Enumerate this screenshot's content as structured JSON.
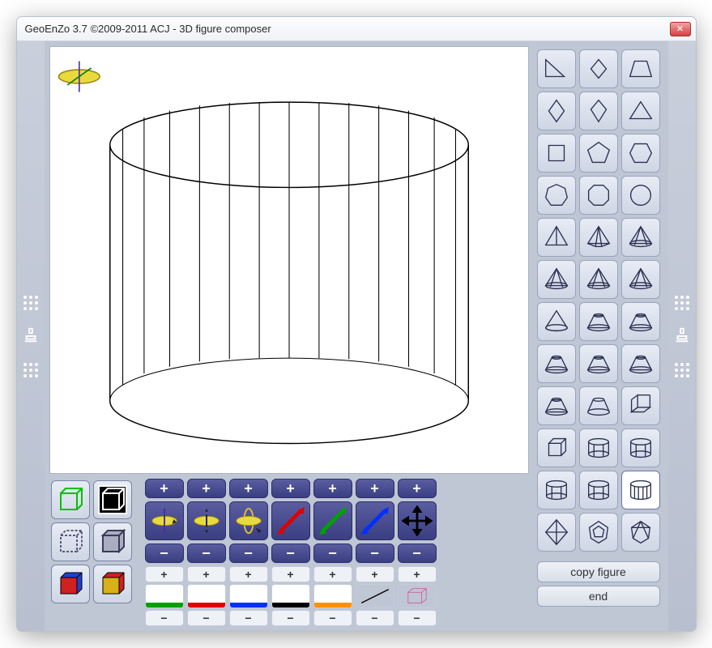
{
  "title": "GeoEnZo 3.7 ©2009-2011 ACJ - 3D figure composer",
  "buttons": {
    "copy_figure": "copy figure",
    "end": "end",
    "plus": "+",
    "minus": "−"
  },
  "render_modes": [
    {
      "name": "wire-green-icon"
    },
    {
      "name": "wire-black-icon"
    },
    {
      "name": "wire-dashed-icon"
    },
    {
      "name": "wire-hidden-icon"
    },
    {
      "name": "solid-color-icon"
    },
    {
      "name": "solid-shade-icon"
    }
  ],
  "transforms": [
    {
      "name": "rotate-z-icon"
    },
    {
      "name": "rotate-y-icon"
    },
    {
      "name": "rotate-x-icon"
    },
    {
      "name": "scale-x-icon"
    },
    {
      "name": "scale-y-icon"
    },
    {
      "name": "scale-z-icon"
    },
    {
      "name": "move-icon"
    }
  ],
  "swatches": [
    {
      "name": "green-swatch",
      "color": "#00a000"
    },
    {
      "name": "red-swatch",
      "color": "#e00000"
    },
    {
      "name": "blue-swatch",
      "color": "#0030ff"
    },
    {
      "name": "black-swatch",
      "color": "#000"
    },
    {
      "name": "orange-swatch",
      "color": "#ff9000"
    }
  ],
  "extra_swatches": [
    {
      "name": "line-style-icon"
    },
    {
      "name": "cube-preview-icon"
    }
  ],
  "shapes": [
    "right-triangle",
    "rhombus",
    "trapezoid",
    "diamond",
    "kite",
    "triangle",
    "square",
    "pentagon",
    "hexagon",
    "heptagon",
    "octagon",
    "circle",
    "tetrahedron",
    "square-pyramid",
    "pentagonal-pyramid",
    "hexagonal-pyramid",
    "heptagonal-pyramid",
    "octagonal-pyramid",
    "cone",
    "frustum-tri",
    "frustum-square",
    "frustum-pent",
    "frustum-hex",
    "frustum-hept",
    "frustum-oct",
    "frustum-cone",
    "wedge-prism",
    "cube",
    "pentagonal-prism",
    "hexagonal-prism",
    "heptagonal-prism",
    "octagonal-prism",
    "cylinder",
    "octahedron",
    "dodecahedron",
    "icosahedron"
  ],
  "selected_shape": "cylinder"
}
